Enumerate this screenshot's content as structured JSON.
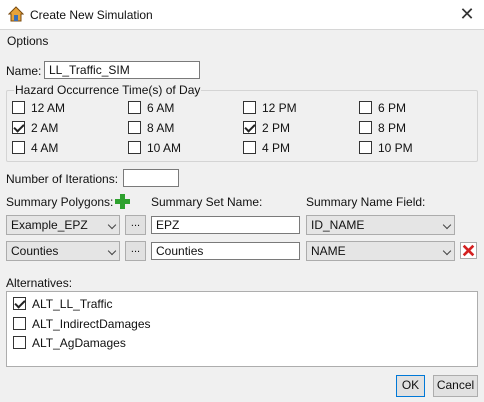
{
  "window": {
    "title": "Create New Simulation",
    "close_glyph": "✕",
    "icon": "app-house-icon"
  },
  "menu": {
    "options_label": "Options"
  },
  "name_field": {
    "label": "Name:",
    "value": "LL_Traffic_SIM"
  },
  "hazard_group": {
    "title": "Hazard Occurrence Time(s) of Day",
    "times": [
      {
        "label": "12 AM",
        "checked": false
      },
      {
        "label": "2 AM",
        "checked": true
      },
      {
        "label": "4 AM",
        "checked": false
      },
      {
        "label": "6 AM",
        "checked": false
      },
      {
        "label": "8 AM",
        "checked": false
      },
      {
        "label": "10 AM",
        "checked": false
      },
      {
        "label": "12 PM",
        "checked": false
      },
      {
        "label": "2 PM",
        "checked": true
      },
      {
        "label": "4 PM",
        "checked": false
      },
      {
        "label": "6 PM",
        "checked": false
      },
      {
        "label": "8 PM",
        "checked": false
      },
      {
        "label": "10 PM",
        "checked": false
      }
    ]
  },
  "iterations": {
    "label": "Number of Iterations:",
    "value": ""
  },
  "summary": {
    "polygons_label": "Summary Polygons:",
    "set_name_label": "Summary Set Name:",
    "name_field_label": "Summary Name Field:",
    "browse_label": "...",
    "rows": [
      {
        "polygon": "Example_EPZ",
        "set_name": "EPZ",
        "name_field": "ID_NAME"
      },
      {
        "polygon": "Counties",
        "set_name": "Counties",
        "name_field": "NAME"
      }
    ]
  },
  "alternatives": {
    "label": "Alternatives:",
    "items": [
      {
        "label": "ALT_LL_Traffic",
        "checked": true
      },
      {
        "label": "ALT_IndirectDamages",
        "checked": false
      },
      {
        "label": "ALT_AgDamages",
        "checked": false
      }
    ]
  },
  "buttons": {
    "ok": "OK",
    "cancel": "Cancel"
  },
  "colors": {
    "add_icon": "#2ea12e",
    "delete_icon": "#d42020",
    "accent": "#0078d7"
  }
}
